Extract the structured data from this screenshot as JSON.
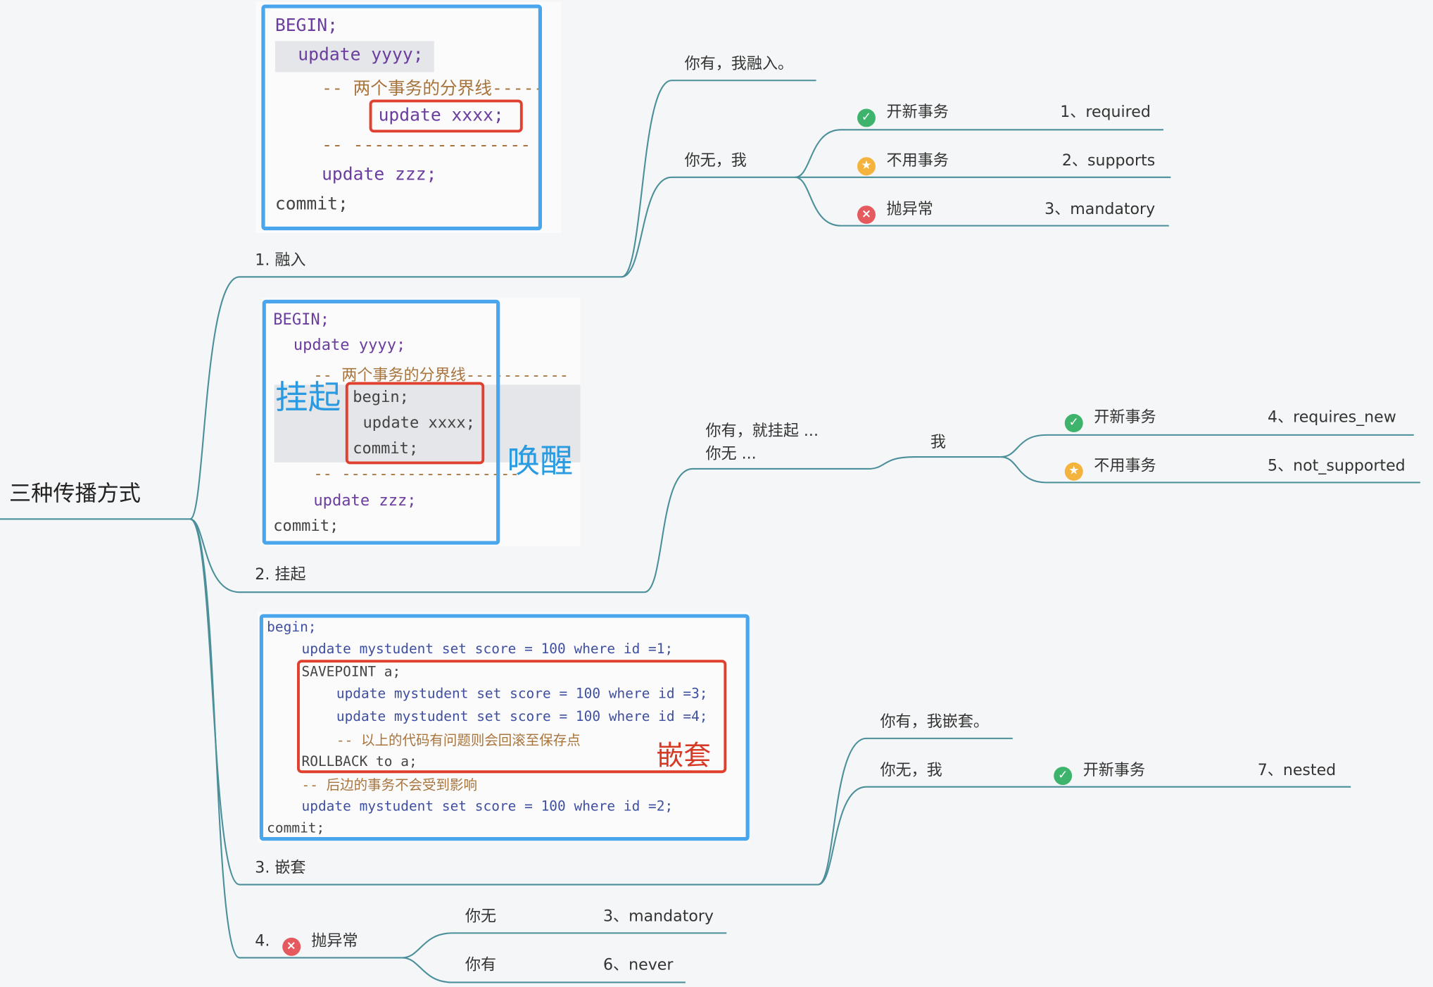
{
  "root": "三种传播方式",
  "branches": {
    "b1": "1. 融入",
    "b2": "2. 挂起",
    "b3": "3. 嵌套",
    "b4_num": "4.",
    "b4_label": "抛异常"
  },
  "b1": {
    "you_have": "你有，我融入。",
    "you_none": "你无，我",
    "items": [
      {
        "icon": "check-icon",
        "label": "开新事务",
        "code": "1、required"
      },
      {
        "icon": "star-icon",
        "label": "不用事务",
        "code": "2、supports"
      },
      {
        "icon": "cross-icon",
        "label": "抛异常",
        "code": "3、mandatory"
      }
    ]
  },
  "b2": {
    "cond1": "你有，就挂起 ...",
    "cond2": "你无 ...",
    "me": "我",
    "items": [
      {
        "icon": "check-icon",
        "label": "开新事务",
        "code": "4、requires_new"
      },
      {
        "icon": "star-icon",
        "label": "不用事务",
        "code": "5、not_supported"
      }
    ]
  },
  "b3": {
    "you_have": "你有，我嵌套。",
    "you_none": "你无，我",
    "item": {
      "icon": "check-icon",
      "label": "开新事务",
      "code": "7、nested"
    }
  },
  "b4": {
    "none": "你无",
    "none_code": "3、mandatory",
    "have": "你有",
    "have_code": "6、never"
  },
  "code1": {
    "l1": "BEGIN;",
    "l2": "update yyyy;",
    "l3": "-- 两个事务的分界线-----",
    "l4": "update xxxx;",
    "l5": "-- -----------------",
    "l6": "update zzz;",
    "l7": "commit;"
  },
  "code2": {
    "l1": "BEGIN;",
    "l2": "update yyyy;",
    "l3": "-- 两个事务的分界线-----------",
    "l4": "begin;",
    "l5": "update xxxx;",
    "l6": "commit;",
    "l7": "-- -------------------",
    "l8": "update zzz;",
    "l9": "commit;",
    "suspend": "挂起",
    "wake": "唤醒"
  },
  "code3": {
    "l1": "begin;",
    "l2": "update mystudent set score = 100 where id =1;",
    "l3": "SAVEPOINT a;",
    "l4": "update mystudent set score = 100 where id =3;",
    "l5": "update mystudent set score = 100 where id =4;",
    "l6": "-- 以上的代码有问题则会回滚至保存点",
    "l7": "ROLLBACK to a;",
    "l8": "-- 后边的事务不会受到影响",
    "l9": "update mystudent set score = 100 where id =2;",
    "l10": "commit;",
    "nest": "嵌套"
  },
  "colors": {
    "line": "#4a8f9a",
    "check": "#3db36b",
    "star": "#f4b33c",
    "cross": "#e45a5e",
    "box_blue": "#49a6ec",
    "box_red": "#e0412f"
  }
}
